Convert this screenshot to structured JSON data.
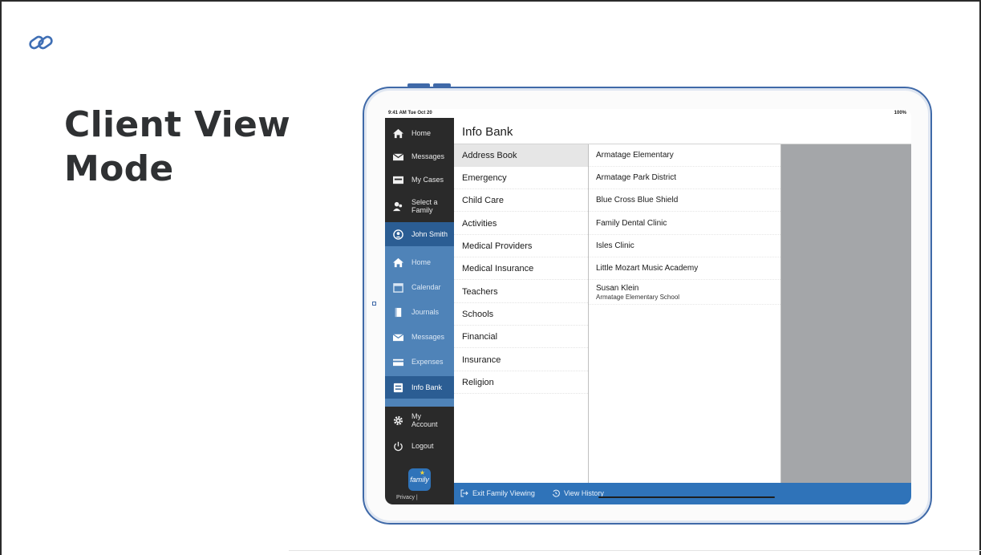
{
  "slide": {
    "title": "Client View Mode",
    "link_icon": "link-icon"
  },
  "device": {
    "status_time": "9:41 AM  Tue Oct 20",
    "status_battery": "100%"
  },
  "sidebar": {
    "top_items": [
      {
        "label": "Home",
        "icon": "home-icon"
      },
      {
        "label": "Messages",
        "icon": "mail-icon"
      },
      {
        "label": "My Cases",
        "icon": "cases-icon"
      },
      {
        "label": "Select a Family",
        "icon": "family-icon"
      }
    ],
    "user": {
      "label": "John Smith",
      "icon": "user-circle-icon"
    },
    "family_items": [
      {
        "label": "Home",
        "icon": "home-icon"
      },
      {
        "label": "Calendar",
        "icon": "calendar-icon"
      },
      {
        "label": "Journals",
        "icon": "journal-icon"
      },
      {
        "label": "Messages",
        "icon": "mail-icon"
      },
      {
        "label": "Expenses",
        "icon": "card-icon"
      },
      {
        "label": "Info Bank",
        "icon": "info-bank-icon",
        "active": true
      }
    ],
    "bottom_items": [
      {
        "label": "My Account",
        "icon": "gear-icon"
      },
      {
        "label": "Logout",
        "icon": "power-icon"
      }
    ],
    "logo_text": "family",
    "privacy": "Privacy |"
  },
  "header": {
    "title": "Info Bank"
  },
  "categories": [
    "Address Book",
    "Emergency",
    "Child Care",
    "Activities",
    "Medical Providers",
    "Medical Insurance",
    "Teachers",
    "Schools",
    "Financial",
    "Insurance",
    "Religion"
  ],
  "selected_category": "Address Book",
  "contacts": [
    {
      "name": "Armatage Elementary"
    },
    {
      "name": "Armatage Park District"
    },
    {
      "name": "Blue Cross Blue Shield"
    },
    {
      "name": "Family Dental Clinic"
    },
    {
      "name": "Isles Clinic"
    },
    {
      "name": "Little Mozart Music Academy"
    },
    {
      "name": "Susan Klein",
      "subtitle": "Armatage Elementary School"
    }
  ],
  "bottom_bar": {
    "exit_label": "Exit Family Viewing",
    "history_label": "View History"
  },
  "colors": {
    "sidebar_bg": "#2a2a2a",
    "family_panel": "#4f83b8",
    "active_item": "#2b5d93",
    "bottom_bar": "#2f73b9",
    "device_frame": "#3f69a8",
    "detail_pane": "#a4a6a9"
  }
}
